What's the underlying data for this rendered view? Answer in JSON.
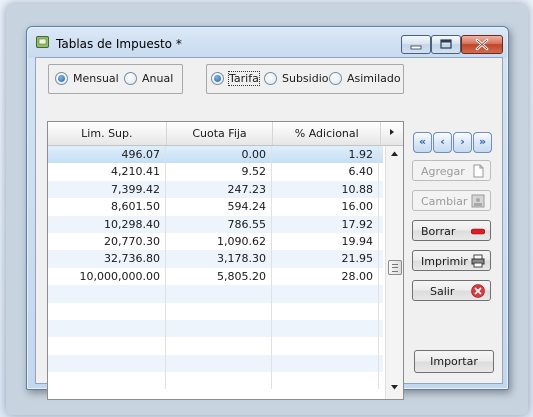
{
  "window": {
    "title": "Tablas de Impuesto *",
    "controls": {
      "minimize": "minimize",
      "maximize": "maximize",
      "close": "close"
    }
  },
  "period_group": {
    "options": [
      {
        "label": "Mensual",
        "selected": true
      },
      {
        "label": "Anual",
        "selected": false
      }
    ]
  },
  "type_group": {
    "options": [
      {
        "label": "Tarifa",
        "selected": true
      },
      {
        "label": "Subsidio",
        "selected": false
      },
      {
        "label": "Asimilado",
        "selected": false
      }
    ]
  },
  "grid": {
    "columns": [
      "Lim. Sup.",
      "Cuota Fija",
      "% Adicional"
    ],
    "rows": [
      [
        "496.07",
        "0.00",
        "1.92"
      ],
      [
        "4,210.41",
        "9.52",
        "6.40"
      ],
      [
        "7,399.42",
        "247.23",
        "10.88"
      ],
      [
        "8,601.50",
        "594.24",
        "16.00"
      ],
      [
        "10,298.40",
        "786.55",
        "17.92"
      ],
      [
        "20,770.30",
        "1,090.62",
        "19.94"
      ],
      [
        "32,736.80",
        "3,178.30",
        "21.95"
      ],
      [
        "10,000,000.00",
        "5,805.20",
        "28.00"
      ]
    ],
    "selected_row": 0
  },
  "navigation": {
    "first": "«",
    "prev": "‹",
    "next": "›",
    "last": "»"
  },
  "actions": {
    "agregar": "Agregar",
    "cambiar": "Cambiar",
    "borrar": "Borrar",
    "imprimir": "Imprimir",
    "salir": "Salir"
  },
  "import_label": "Importar",
  "colors": {
    "accent": "#1d5fae",
    "close_red": "#c0442a",
    "delete_red": "#e01b24"
  }
}
